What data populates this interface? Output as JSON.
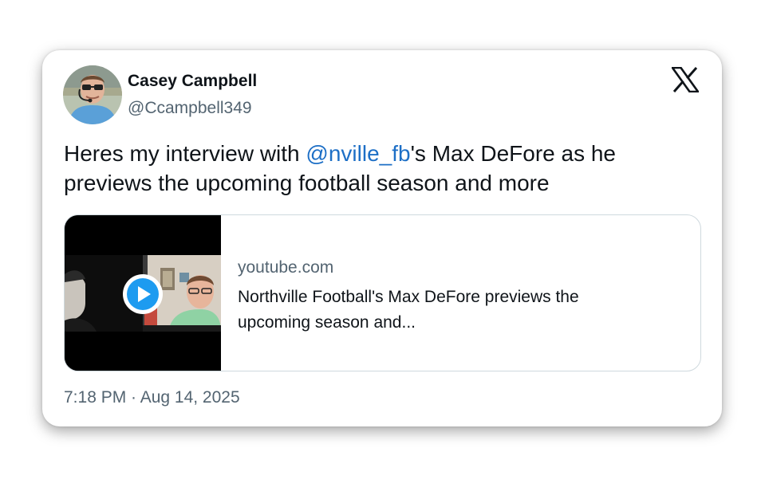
{
  "author": {
    "display_name": "Casey Campbell",
    "handle": "@Ccampbell349"
  },
  "tweet": {
    "text_before": "Heres my interview with ",
    "mention": "@nville_fb",
    "text_after": "'s Max DeFore as he previews the upcoming football season and more",
    "timestamp": "7:18 PM · Aug 14, 2025"
  },
  "link_card": {
    "domain": "youtube.com",
    "title": "Northville Football's Max DeFore previews the upcoming season and..."
  },
  "icons": {
    "brand": "x-logo-icon",
    "play": "play-icon"
  },
  "colors": {
    "mention": "#1d6fc6",
    "play_button": "#1d9bf0",
    "secondary_text": "#536471"
  }
}
